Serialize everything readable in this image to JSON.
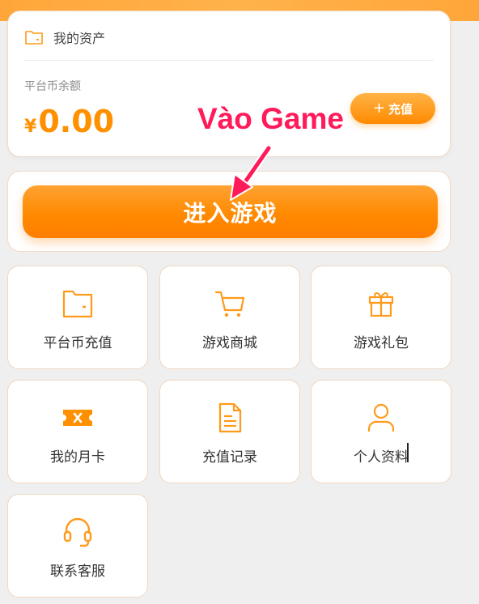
{
  "asset": {
    "title": "我的资产",
    "balance_label": "平台币余额",
    "currency_symbol": "¥",
    "balance": "0.00",
    "recharge_plus": "+",
    "recharge_label": "充值"
  },
  "enter_game": {
    "label": "进入游戏"
  },
  "annotation": {
    "text": "Vào Game"
  },
  "tiles": [
    {
      "label": "平台币充值",
      "icon": "wallet-icon"
    },
    {
      "label": "游戏商城",
      "icon": "cart-icon"
    },
    {
      "label": "游戏礼包",
      "icon": "gift-icon"
    },
    {
      "label": "我的月卡",
      "icon": "ticket-icon"
    },
    {
      "label": "充值记录",
      "icon": "document-icon"
    },
    {
      "label": "个人资料",
      "icon": "user-icon"
    },
    {
      "label": "联系客服",
      "icon": "headset-icon"
    }
  ],
  "colors": {
    "accent": "#ff9000",
    "annotation": "#ff1a5a"
  }
}
